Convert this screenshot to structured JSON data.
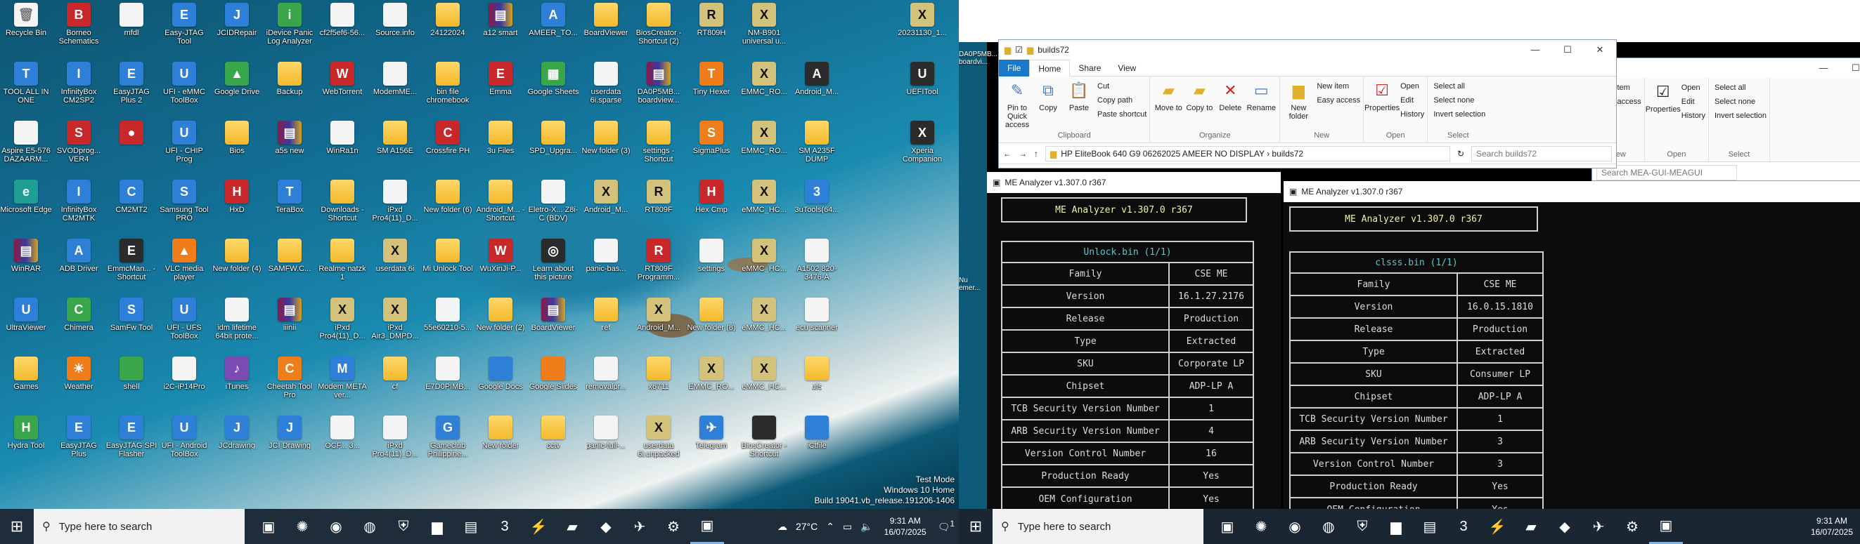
{
  "monitor1": {
    "icons": [
      {
        "label": "Recycle Bin",
        "glyph": "🗑",
        "cls": "ic-file"
      },
      {
        "label": "Borneo Schematics",
        "glyph": "B",
        "cls": "ic-red"
      },
      {
        "label": "mfdl",
        "glyph": "",
        "cls": "ic-file"
      },
      {
        "label": "Easy-JTAG Tool",
        "glyph": "E",
        "cls": "ic-app"
      },
      {
        "label": "JCIDRepair",
        "glyph": "J",
        "cls": "ic-app"
      },
      {
        "label": "iDevice Panic Log Analyzer",
        "glyph": "i",
        "cls": "ic-green"
      },
      {
        "label": "cf2f5ef6-56...",
        "glyph": "",
        "cls": "ic-file"
      },
      {
        "label": "Source.info",
        "glyph": "",
        "cls": "ic-file"
      },
      {
        "label": "24122024",
        "glyph": "",
        "cls": "ic-folder"
      },
      {
        "label": "a12 smart",
        "glyph": "▤",
        "cls": "ic-rar"
      },
      {
        "label": "AMEER_TO...",
        "glyph": "A",
        "cls": "ic-app"
      },
      {
        "label": "BoardViewer",
        "glyph": "",
        "cls": "ic-folder"
      },
      {
        "label": "BiosCreator - Shortcut (2)",
        "glyph": "",
        "cls": "ic-folder"
      },
      {
        "label": "RT809H",
        "glyph": "R",
        "cls": "ic-x"
      },
      {
        "label": "NM-B901 universal u...",
        "glyph": "X",
        "cls": "ic-x"
      },
      {
        "label": "",
        "glyph": "",
        "cls": ""
      },
      {
        "label": "",
        "glyph": "",
        "cls": ""
      },
      {
        "label": "20231130_1...",
        "glyph": "X",
        "cls": "ic-x"
      },
      {
        "label": "TOOL ALL IN ONE",
        "glyph": "T",
        "cls": "ic-app"
      },
      {
        "label": "InfinityBox CM2SP2",
        "glyph": "I",
        "cls": "ic-app"
      },
      {
        "label": "EasyJTAG Plus 2",
        "glyph": "E",
        "cls": "ic-app"
      },
      {
        "label": "UFI - eMMC ToolBox",
        "glyph": "U",
        "cls": "ic-app"
      },
      {
        "label": "Google Drive",
        "glyph": "▲",
        "cls": "ic-green"
      },
      {
        "label": "Backup",
        "glyph": "",
        "cls": "ic-folder"
      },
      {
        "label": "WebTorrent",
        "glyph": "W",
        "cls": "ic-red"
      },
      {
        "label": "ModemME...",
        "glyph": "",
        "cls": "ic-file"
      },
      {
        "label": "bin file chromebook",
        "glyph": "",
        "cls": "ic-folder"
      },
      {
        "label": "Emma",
        "glyph": "E",
        "cls": "ic-red"
      },
      {
        "label": "Google Sheets",
        "glyph": "▦",
        "cls": "ic-green"
      },
      {
        "label": "userdata 6i.sparse",
        "glyph": "",
        "cls": "ic-file"
      },
      {
        "label": "DA0P5MB... boardview...",
        "glyph": "▤",
        "cls": "ic-rar"
      },
      {
        "label": "Tiny Hexer",
        "glyph": "T",
        "cls": "ic-orange"
      },
      {
        "label": "EMMC_RO...",
        "glyph": "X",
        "cls": "ic-x"
      },
      {
        "label": "Android_M...",
        "glyph": "A",
        "cls": "ic-dark"
      },
      {
        "label": "",
        "glyph": "",
        "cls": ""
      },
      {
        "label": "UEFITool",
        "glyph": "U",
        "cls": "ic-dark"
      },
      {
        "label": "Aspire E5-576 DAZAARM...",
        "glyph": "",
        "cls": "ic-file"
      },
      {
        "label": "SVODprog... VER4",
        "glyph": "S",
        "cls": "ic-red"
      },
      {
        "label": "",
        "glyph": "●",
        "cls": "ic-red"
      },
      {
        "label": "UFI - CHIP Prog",
        "glyph": "U",
        "cls": "ic-app"
      },
      {
        "label": "Bios",
        "glyph": "",
        "cls": "ic-folder"
      },
      {
        "label": "a5s new",
        "glyph": "▤",
        "cls": "ic-rar"
      },
      {
        "label": "WinRa1n",
        "glyph": "",
        "cls": "ic-file"
      },
      {
        "label": "SM A156E",
        "glyph": "",
        "cls": "ic-folder"
      },
      {
        "label": "Crossfire PH",
        "glyph": "C",
        "cls": "ic-red"
      },
      {
        "label": "3u Files",
        "glyph": "",
        "cls": "ic-folder"
      },
      {
        "label": "SPD_Upgra...",
        "glyph": "",
        "cls": "ic-folder"
      },
      {
        "label": "New folder (3)",
        "glyph": "",
        "cls": "ic-folder"
      },
      {
        "label": "settings - Shortcut",
        "glyph": "",
        "cls": "ic-folder"
      },
      {
        "label": "SigmaPlus",
        "glyph": "S",
        "cls": "ic-orange"
      },
      {
        "label": "EMMC_RO...",
        "glyph": "X",
        "cls": "ic-x"
      },
      {
        "label": "SM A235F DUMP",
        "glyph": "",
        "cls": "ic-folder"
      },
      {
        "label": "",
        "glyph": "",
        "cls": ""
      },
      {
        "label": "Xperia Companion",
        "glyph": "X",
        "cls": "ic-dark"
      },
      {
        "label": "Microsoft Edge",
        "glyph": "e",
        "cls": "ic-teal"
      },
      {
        "label": "InfinityBox CM2MTK",
        "glyph": "I",
        "cls": "ic-app"
      },
      {
        "label": "CM2MT2",
        "glyph": "C",
        "cls": "ic-app"
      },
      {
        "label": "Samsung Tool PRO",
        "glyph": "S",
        "cls": "ic-app"
      },
      {
        "label": "HxD",
        "glyph": "H",
        "cls": "ic-red"
      },
      {
        "label": "TeraBox",
        "glyph": "T",
        "cls": "ic-app"
      },
      {
        "label": "Downloads - Shortcut",
        "glyph": "",
        "cls": "ic-folder"
      },
      {
        "label": "iPxd Pro4(11)_D...",
        "glyph": "",
        "cls": "ic-file"
      },
      {
        "label": "New folder (6)",
        "glyph": "",
        "cls": "ic-folder"
      },
      {
        "label": "Android_M... - Shortcut",
        "glyph": "",
        "cls": "ic-folder"
      },
      {
        "label": "Eletro-X... Z8i-C (BDV)",
        "glyph": "",
        "cls": "ic-file"
      },
      {
        "label": "Android_M...",
        "glyph": "X",
        "cls": "ic-x"
      },
      {
        "label": "RT809F",
        "glyph": "R",
        "cls": "ic-x"
      },
      {
        "label": "Hex Cmp",
        "glyph": "H",
        "cls": "ic-red"
      },
      {
        "label": "eMMC_HC...",
        "glyph": "X",
        "cls": "ic-x"
      },
      {
        "label": "3uTools(64...",
        "glyph": "3",
        "cls": "ic-app"
      },
      {
        "label": "",
        "glyph": "",
        "cls": ""
      },
      {
        "label": "",
        "glyph": "",
        "cls": ""
      },
      {
        "label": "WinRAR",
        "glyph": "▤",
        "cls": "ic-rar"
      },
      {
        "label": "ADB Driver",
        "glyph": "A",
        "cls": "ic-app"
      },
      {
        "label": "EmmcMan... - Shortcut",
        "glyph": "E",
        "cls": "ic-dark"
      },
      {
        "label": "VLC media player",
        "glyph": "▲",
        "cls": "ic-orange"
      },
      {
        "label": "New folder (4)",
        "glyph": "",
        "cls": "ic-folder"
      },
      {
        "label": "SAMFW.C...",
        "glyph": "",
        "cls": "ic-folder"
      },
      {
        "label": "Realme natzk 1",
        "glyph": "",
        "cls": "ic-folder"
      },
      {
        "label": "userdata 6i",
        "glyph": "X",
        "cls": "ic-x"
      },
      {
        "label": "Mi Unlock Tool",
        "glyph": "",
        "cls": "ic-folder"
      },
      {
        "label": "WuXinJi-P...",
        "glyph": "W",
        "cls": "ic-red"
      },
      {
        "label": "Learn about this picture",
        "glyph": "◎",
        "cls": "ic-dark"
      },
      {
        "label": "panic-bas...",
        "glyph": "",
        "cls": "ic-file"
      },
      {
        "label": "RT809F Programm...",
        "glyph": "R",
        "cls": "ic-red"
      },
      {
        "label": "settings",
        "glyph": "",
        "cls": "ic-file"
      },
      {
        "label": "eMMC_HC...",
        "glyph": "X",
        "cls": "ic-x"
      },
      {
        "label": "A1502 820-3476-A",
        "glyph": "",
        "cls": "ic-file"
      },
      {
        "label": "",
        "glyph": "",
        "cls": ""
      },
      {
        "label": "",
        "glyph": "",
        "cls": ""
      },
      {
        "label": "UltraViewer",
        "glyph": "U",
        "cls": "ic-app"
      },
      {
        "label": "Chimera",
        "glyph": "C",
        "cls": "ic-green"
      },
      {
        "label": "SamFw Tool",
        "glyph": "S",
        "cls": "ic-app"
      },
      {
        "label": "UFI - UFS ToolBox",
        "glyph": "U",
        "cls": "ic-app"
      },
      {
        "label": "idm lifetime 64bit prote...",
        "glyph": "",
        "cls": "ic-file"
      },
      {
        "label": "iiinii",
        "glyph": "▤",
        "cls": "ic-rar"
      },
      {
        "label": "iPxd Pro4(11)_D...",
        "glyph": "X",
        "cls": "ic-x"
      },
      {
        "label": "iPxd Air3_DMPD...",
        "glyph": "X",
        "cls": "ic-x"
      },
      {
        "label": "55e60210-5...",
        "glyph": "",
        "cls": "ic-file"
      },
      {
        "label": "New folder (2)",
        "glyph": "",
        "cls": "ic-folder"
      },
      {
        "label": "BoardViewer",
        "glyph": "▤",
        "cls": "ic-rar"
      },
      {
        "label": "ref",
        "glyph": "",
        "cls": "ic-folder"
      },
      {
        "label": "Android_M...",
        "glyph": "X",
        "cls": "ic-x"
      },
      {
        "label": "New folder (8)",
        "glyph": "",
        "cls": "ic-folder"
      },
      {
        "label": "eMMC_HC...",
        "glyph": "X",
        "cls": "ic-x"
      },
      {
        "label": "ecu scanner",
        "glyph": "",
        "cls": "ic-file"
      },
      {
        "label": "",
        "glyph": "",
        "cls": ""
      },
      {
        "label": "",
        "glyph": "",
        "cls": ""
      },
      {
        "label": "Games",
        "glyph": "",
        "cls": "ic-folder"
      },
      {
        "label": "Weather",
        "glyph": "☀",
        "cls": "ic-orange"
      },
      {
        "label": "shell",
        "glyph": "",
        "cls": "ic-green"
      },
      {
        "label": "i2C-iP14Pro",
        "glyph": "",
        "cls": "ic-file"
      },
      {
        "label": "iTunes",
        "glyph": "♪",
        "cls": "ic-purple"
      },
      {
        "label": "Cheetah Tool Pro",
        "glyph": "C",
        "cls": "ic-orange"
      },
      {
        "label": "Modem META ver...",
        "glyph": "M",
        "cls": "ic-app"
      },
      {
        "label": "cf",
        "glyph": "",
        "cls": "ic-folder"
      },
      {
        "label": "E7D0PIMB...",
        "glyph": "",
        "cls": "ic-file"
      },
      {
        "label": "Google Docs",
        "glyph": "",
        "cls": "ic-app"
      },
      {
        "label": "Google Slides",
        "glyph": "",
        "cls": "ic-orange"
      },
      {
        "label": "removalpr...",
        "glyph": "",
        "cls": "ic-file"
      },
      {
        "label": "x6711",
        "glyph": "",
        "cls": "ic-folder"
      },
      {
        "label": "EMMC_RO...",
        "glyph": "X",
        "cls": "ic-x"
      },
      {
        "label": "eMMC_HC...",
        "glyph": "X",
        "cls": "ic-x"
      },
      {
        "label": "ufs",
        "glyph": "",
        "cls": "ic-folder"
      },
      {
        "label": "",
        "glyph": "",
        "cls": ""
      },
      {
        "label": "",
        "glyph": "",
        "cls": ""
      },
      {
        "label": "Hydra Tool",
        "glyph": "H",
        "cls": "ic-green"
      },
      {
        "label": "EasyJTAG Plus",
        "glyph": "E",
        "cls": "ic-app"
      },
      {
        "label": "EasyJTAG SPI Flasher",
        "glyph": "E",
        "cls": "ic-app"
      },
      {
        "label": "UFI - Android ToolBox",
        "glyph": "U",
        "cls": "ic-app"
      },
      {
        "label": "JCdrawing",
        "glyph": "J",
        "cls": "ic-app"
      },
      {
        "label": "JCI Drawing",
        "glyph": "J",
        "cls": "ic-app"
      },
      {
        "label": "OCF... 3...",
        "glyph": "",
        "cls": "ic-file"
      },
      {
        "label": "iPxd Pro4(11)_D...",
        "glyph": "",
        "cls": "ic-file"
      },
      {
        "label": "Gameclub Philippine...",
        "glyph": "G",
        "cls": "ic-app"
      },
      {
        "label": "New folder",
        "glyph": "",
        "cls": "ic-folder"
      },
      {
        "label": "cctv",
        "glyph": "",
        "cls": "ic-folder"
      },
      {
        "label": "panic-full-...",
        "glyph": "",
        "cls": "ic-file"
      },
      {
        "label": "userdata 6i.unpacked",
        "glyph": "X",
        "cls": "ic-x"
      },
      {
        "label": "Telegram",
        "glyph": "✈",
        "cls": "ic-app"
      },
      {
        "label": "BiosCreator - Shortcut",
        "glyph": "",
        "cls": "ic-dark"
      },
      {
        "label": "iCtfile",
        "glyph": "",
        "cls": "ic-app"
      },
      {
        "label": "",
        "glyph": "",
        "cls": ""
      },
      {
        "label": "",
        "glyph": "",
        "cls": ""
      }
    ],
    "watermark": {
      "line1": "Test Mode",
      "line2": "Windows 10 Home",
      "line3": "Build 19041.vb_release.191206-1406"
    },
    "taskbar": {
      "search_placeholder": "Type here to search",
      "weather": "27°C",
      "time": "9:31 AM",
      "date": "16/07/2025",
      "notif_count": "1"
    }
  },
  "explorer_left": {
    "title": "builds72",
    "tabs": [
      "File",
      "Home",
      "Share",
      "View"
    ],
    "ribbon": {
      "clipboard": {
        "pin": "Pin to Quick access",
        "copy": "Copy",
        "paste": "Paste",
        "cut": "Cut",
        "copy_path": "Copy path",
        "paste_shortcut": "Paste shortcut",
        "name": "Clipboard"
      },
      "organize": {
        "move": "Move to",
        "copyto": "Copy to",
        "delete": "Delete",
        "rename": "Rename",
        "name": "Organize"
      },
      "new": {
        "new_folder": "New folder",
        "new_item": "New item",
        "easy": "Easy access",
        "name": "New"
      },
      "open": {
        "properties": "Properties",
        "open": "Open",
        "edit": "Edit",
        "history": "History",
        "name": "Open"
      },
      "select": {
        "all": "Select all",
        "none": "Select none",
        "invert": "Invert selection",
        "name": "Select"
      }
    },
    "path": "HP EliteBook 640 G9 06262025 AMEER NO DISPLAY › builds72",
    "search_placeholder": "Search builds72"
  },
  "explorer_right": {
    "search_placeholder": "Search MEA-GUI-MEAGUI",
    "ribbon": {
      "new_item": "New item",
      "easy": "Easy access",
      "new_name": "New",
      "properties": "Properties",
      "open": "Open",
      "edit": "Edit",
      "history": "History",
      "open_name": "Open",
      "all": "Select all",
      "none": "Select none",
      "invert": "Invert selection",
      "select_name": "Select"
    }
  },
  "me1": {
    "window_title": "ME Analyzer v1.307.0 r367",
    "header": "ME Analyzer v1.307.0 r367",
    "file": "Unlock.bin (1/1)",
    "rows": [
      {
        "k": "Family",
        "v": "CSE ME"
      },
      {
        "k": "Version",
        "v": "16.1.27.2176"
      },
      {
        "k": "Release",
        "v": "Production"
      },
      {
        "k": "Type",
        "v": "Extracted"
      },
      {
        "k": "SKU",
        "v": "Corporate LP"
      },
      {
        "k": "Chipset",
        "v": "ADP-LP A"
      },
      {
        "k": "TCB Security Version Number",
        "v": "1"
      },
      {
        "k": "ARB Security Version Number",
        "v": "4"
      },
      {
        "k": "Version Control Number",
        "v": "16"
      },
      {
        "k": "Production Ready",
        "v": "Yes"
      },
      {
        "k": "OEM Configuration",
        "v": "Yes"
      }
    ]
  },
  "me2": {
    "window_title": "ME Analyzer v1.307.0 r367",
    "header": "ME Analyzer v1.307.0 r367",
    "file": "clsss.bin (1/1)",
    "rows": [
      {
        "k": "Family",
        "v": "CSE ME"
      },
      {
        "k": "Version",
        "v": "16.0.15.1810"
      },
      {
        "k": "Release",
        "v": "Production"
      },
      {
        "k": "Type",
        "v": "Extracted"
      },
      {
        "k": "SKU",
        "v": "Consumer LP"
      },
      {
        "k": "Chipset",
        "v": "ADP-LP A"
      },
      {
        "k": "TCB Security Version Number",
        "v": "1"
      },
      {
        "k": "ARB Security Version Number",
        "v": "3"
      },
      {
        "k": "Version Control Number",
        "v": "3"
      },
      {
        "k": "Production Ready",
        "v": "Yes"
      },
      {
        "k": "OEM Configuration",
        "v": "Yes"
      }
    ]
  },
  "monitor2": {
    "side_labels": {
      "top": "DA0P5MB... boardvi...",
      "mid": "Nu emer..."
    },
    "taskbar": {
      "search_placeholder": "Type here to search",
      "time": "9:31 AM",
      "date": "16/07/2025"
    }
  }
}
